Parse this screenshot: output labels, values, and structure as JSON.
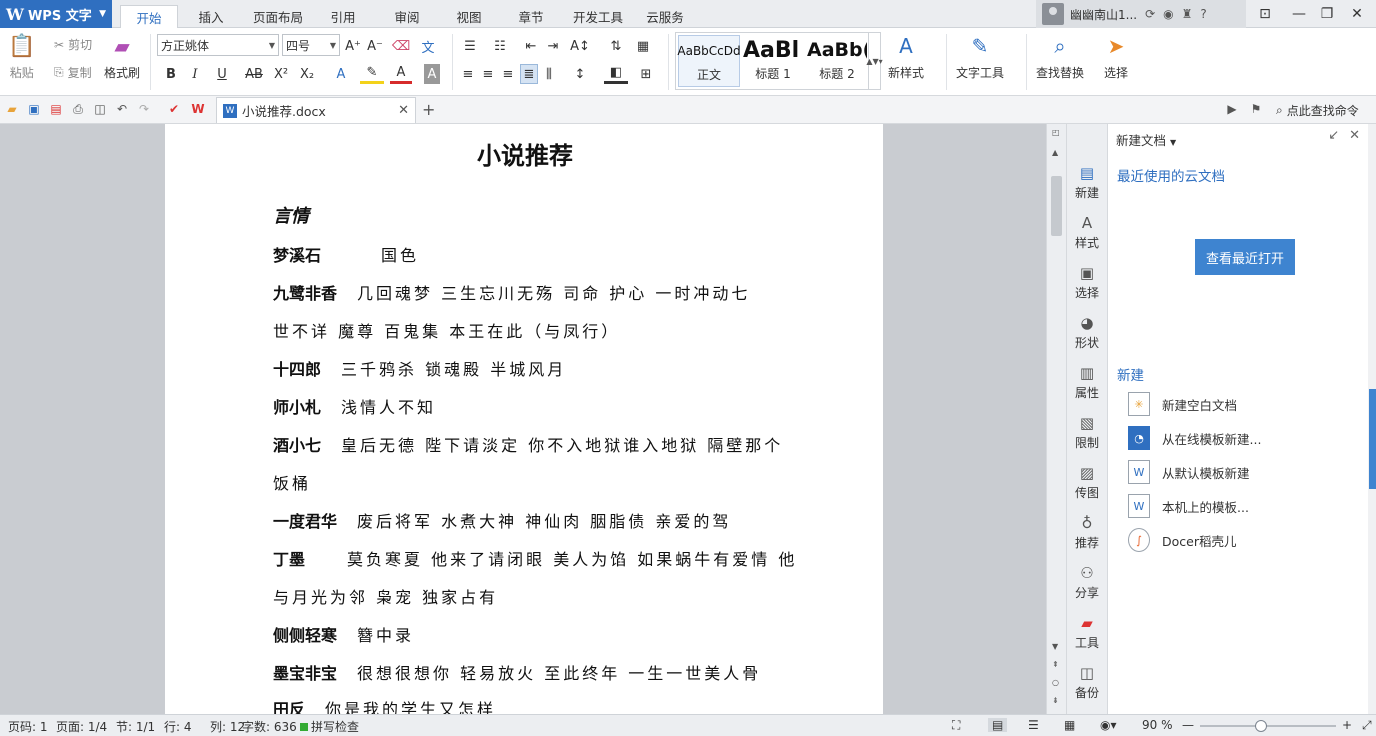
{
  "app": {
    "name": "WPS 文字"
  },
  "menu_tabs": [
    "开始",
    "插入",
    "页面布局",
    "引用",
    "审阅",
    "视图",
    "章节",
    "开发工具",
    "云服务"
  ],
  "active_tab": "开始",
  "user": {
    "name": "幽幽南山1..."
  },
  "ribbon": {
    "paste": "粘贴",
    "cut": "剪切",
    "copy": "复制",
    "format_painter": "格式刷",
    "font_name": "方正姚体",
    "font_size": "四号",
    "styles": [
      {
        "sample": "AaBbCcDd",
        "name": "正文"
      },
      {
        "sample": "AaBl",
        "name": "标题 1"
      },
      {
        "sample": "AaBb(",
        "name": "标题 2"
      }
    ],
    "new_style": "新样式",
    "text_tools": "文字工具",
    "find_replace": "查找替换",
    "select": "选择"
  },
  "qat": {
    "doc_tab": "小说推荐.docx",
    "find_cmd": "点此查找命令"
  },
  "document": {
    "title": "小说推荐",
    "genre": "言情",
    "lines": [
      {
        "author": "梦溪石",
        "works": "国色"
      },
      {
        "author": "九鹭非香",
        "works": "几回魂梦   三生忘川无殇   司命   护心   一时冲动七"
      },
      {
        "author": "",
        "works": "世不详   魔尊  百鬼集   本王在此（与凤行）"
      },
      {
        "author": "十四郎",
        "works": "三千鸦杀   锁魂殿   半城风月"
      },
      {
        "author": "师小札",
        "works": "浅情人不知"
      },
      {
        "author": "酒小七",
        "works": "皇后无德   陛下请淡定   你不入地狱谁入地狱   隔壁那个"
      },
      {
        "author": "",
        "works": "饭桶"
      },
      {
        "author": "一度君华",
        "works": "废后将军   水煮大神   神仙肉   胭脂债  亲爱的驾"
      },
      {
        "author": "丁墨",
        "works": "莫负寒夏   他来了请闭眼  美人为馅   如果蜗牛有爱情  他"
      },
      {
        "author": "",
        "works": "与月光为邻   枭宠   独家占有"
      },
      {
        "author": "侧侧轻寒",
        "works": "簪中录"
      },
      {
        "author": "墨宝非宝",
        "works": "很想很想你   轻易放火   至此终年   一生一世美人骨"
      },
      {
        "author": "田反",
        "works": "你是我的学生又怎样"
      }
    ]
  },
  "sidebar": [
    "新建",
    "样式",
    "选择",
    "形状",
    "属性",
    "限制",
    "传图",
    "推荐",
    "分享",
    "工具",
    "备份"
  ],
  "taskpane": {
    "title": "新建文档",
    "recent_header": "最近使用的云文档",
    "open_recent_button": "查看最近打开",
    "new_header": "新建",
    "items": [
      "新建空白文档",
      "从在线模板新建...",
      "从默认模板新建",
      "本机上的模板...",
      "Docer稻壳儿"
    ]
  },
  "status": {
    "page_code": "页码: 1",
    "page": "页面: 1/4",
    "section": "节: 1/1",
    "row": "行: 4",
    "col": "列: 12",
    "word_count": "字数: 636",
    "spell_check": "拼写检查",
    "zoom": "90 %",
    "zoom_value": 0.45
  },
  "colors": {
    "accent": "#2f6fc0",
    "button": "#3e84d0"
  }
}
